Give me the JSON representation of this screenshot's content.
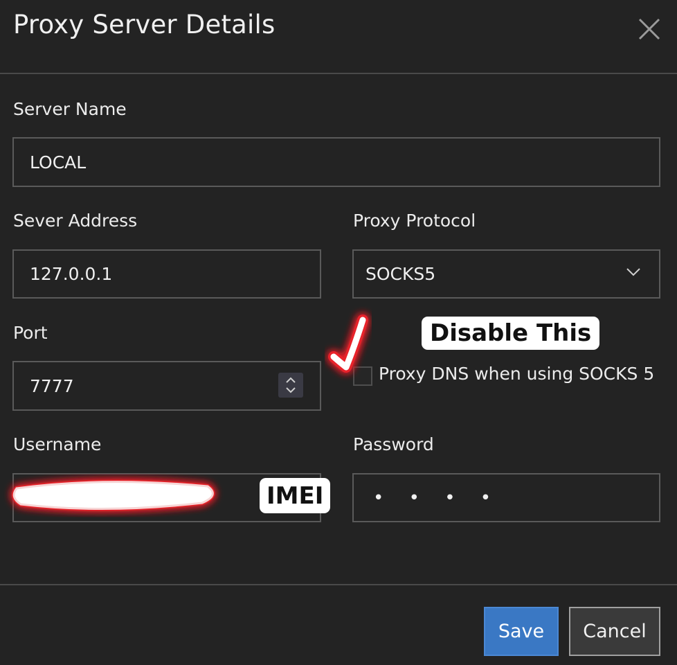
{
  "dialog": {
    "title": "Proxy Server Details",
    "close_icon": "close-icon"
  },
  "form": {
    "server_name": {
      "label": "Server Name",
      "value": "LOCAL"
    },
    "server_address": {
      "label": "Sever Address",
      "value": "127.0.0.1"
    },
    "proxy_protocol": {
      "label": "Proxy Protocol",
      "value": "SOCKS5"
    },
    "port": {
      "label": "Port",
      "value": "7777"
    },
    "proxy_dns": {
      "label": "Proxy DNS when using SOCKS 5",
      "checked": false
    },
    "username": {
      "label": "Username",
      "value": ""
    },
    "password": {
      "label": "Password",
      "value": "• • • •"
    }
  },
  "annotations": {
    "disable_note": "Disable This",
    "username_note": "IMEI",
    "highlight_color": "#e8222a"
  },
  "footer": {
    "save_label": "Save",
    "cancel_label": "Cancel"
  }
}
